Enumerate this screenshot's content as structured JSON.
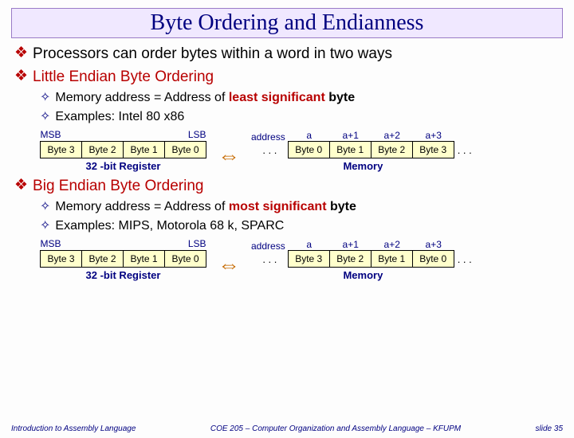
{
  "title": "Byte Ordering and Endianness",
  "b1": "Processors can order bytes within a word in two ways",
  "b2": "Little Endian Byte Ordering",
  "b2a_pre": "Memory address = Address of ",
  "b2a_em": "least significant",
  "b2a_post": "  byte",
  "b2b": "Examples: Intel 80 x86",
  "b3": "Big Endian Byte Ordering",
  "b3a_pre": "Memory address = Address of ",
  "b3a_em": "most significant",
  "b3a_post": " byte",
  "b3b": "Examples: MIPS, Motorola 68 k, SPARC",
  "reg": {
    "msb": "MSB",
    "lsb": "LSB",
    "c0": "Byte 3",
    "c1": "Byte 2",
    "c2": "Byte 1",
    "c3": "Byte 0",
    "caption": "32 -bit Register"
  },
  "mem": {
    "addr_label": "address",
    "a0": "a",
    "a1": "a+1",
    "a2": "a+2",
    "a3": "a+3",
    "dots": ". . .",
    "caption": "Memory"
  },
  "little": {
    "m0": "Byte 0",
    "m1": "Byte 1",
    "m2": "Byte 2",
    "m3": "Byte 3"
  },
  "big": {
    "m0": "Byte 3",
    "m1": "Byte 2",
    "m2": "Byte 1",
    "m3": "Byte 0"
  },
  "footer": {
    "left": "Introduction to Assembly Language",
    "mid": "COE 205 – Computer Organization and Assembly Language – KFUPM",
    "right": "slide 35"
  }
}
